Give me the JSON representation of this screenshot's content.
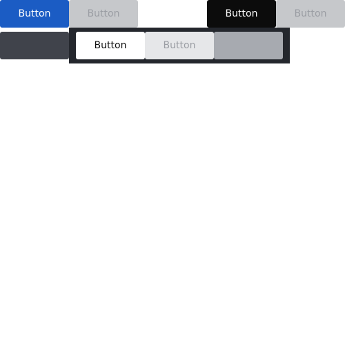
{
  "row1": {
    "primary": {
      "label": "Button"
    },
    "primary_disabled": {
      "label": "Button"
    },
    "dark": {
      "label": "Button"
    },
    "dark_disabled": {
      "label": "Button"
    }
  },
  "row2": {
    "ghost_dark": {
      "label": ""
    },
    "panel": {
      "light": {
        "label": "Button"
      },
      "light_disabled": {
        "label": "Button"
      },
      "ghost_light": {
        "label": ""
      }
    }
  },
  "colors": {
    "primary_bg": "#1b5cc4",
    "disabled_bg": "#c6c8cb",
    "disabled_text": "#9a9da3",
    "dark_bg": "#0c0c0c",
    "slate_bg": "#40434b",
    "panel_bg": "#24272d",
    "light_bg": "#ffffff",
    "light_disabled_bg": "#e6e7e9",
    "ghost_light_bg": "#a7aab0"
  }
}
